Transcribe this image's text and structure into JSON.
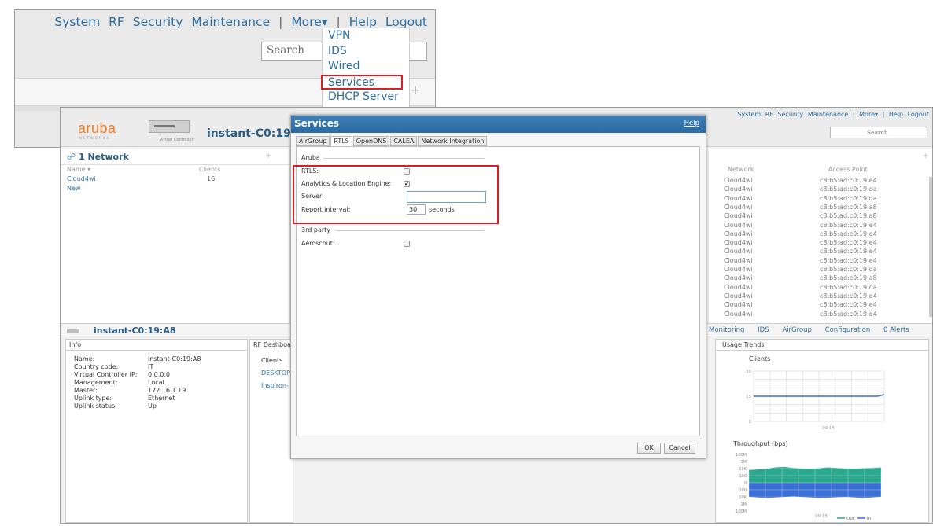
{
  "zoom_inset": {
    "nav": [
      "System",
      "RF",
      "Security",
      "Maintenance",
      "|",
      "More▾",
      "|",
      "Help",
      "Logout"
    ],
    "search_placeholder": "Search",
    "menu": [
      "VPN",
      "IDS",
      "Wired",
      "Services",
      "DHCP Server"
    ],
    "selected_item": "Services",
    "plus": "+"
  },
  "header": {
    "logo": "aruba",
    "logo_sub": "NETWORKS",
    "vc_label": "Virtual Controller",
    "vc_name": "instant-C0:19:",
    "nav": [
      "System",
      "RF",
      "Security",
      "Maintenance",
      "|",
      "More▾",
      "|",
      "Help",
      "Logout"
    ],
    "search_placeholder": "Search"
  },
  "networks": {
    "title": "1 Network",
    "plus": "+",
    "col_name": "Name ▾",
    "col_clients": "Clients",
    "rows": [
      {
        "name": "Cloud4wi",
        "clients": "16"
      }
    ],
    "new_link": "New"
  },
  "clients": {
    "plus": "+",
    "col_network": "Network",
    "col_ap": "Access Point",
    "rows": [
      {
        "network": "Cloud4wi",
        "ap": "c8:b5:ad:c0:19:e4"
      },
      {
        "network": "Cloud4wi",
        "ap": "c8:b5:ad:c0:19:da"
      },
      {
        "network": "Cloud4wi",
        "ap": "c8:b5:ad:c0:19:da"
      },
      {
        "network": "Cloud4wi",
        "ap": "c8:b5:ad:c0:19:a8"
      },
      {
        "network": "Cloud4wi",
        "ap": "c8:b5:ad:c0:19:a8"
      },
      {
        "network": "Cloud4wi",
        "ap": "c8:b5:ad:c0:19:e4"
      },
      {
        "network": "Cloud4wi",
        "ap": "c8:b5:ad:c0:19:e4"
      },
      {
        "network": "Cloud4wi",
        "ap": "c8:b5:ad:c0:19:e4"
      },
      {
        "network": "Cloud4wi",
        "ap": "c8:b5:ad:c0:19:e4"
      },
      {
        "network": "Cloud4wi",
        "ap": "c8:b5:ad:c0:19:e4"
      },
      {
        "network": "Cloud4wi",
        "ap": "c8:b5:ad:c0:19:da"
      },
      {
        "network": "Cloud4wi",
        "ap": "c8:b5:ad:c0:19:a8"
      },
      {
        "network": "Cloud4wi",
        "ap": "c8:b5:ad:c0:19:da"
      },
      {
        "network": "Cloud4wi",
        "ap": "c8:b5:ad:c0:19:e4"
      },
      {
        "network": "Cloud4wi",
        "ap": "c8:b5:ad:c0:19:e4"
      },
      {
        "network": "Cloud4wi",
        "ap": "c8:b5:ad:c0:19:e4"
      }
    ]
  },
  "lower": {
    "name": "instant-C0:19:A8",
    "tabs": [
      "Monitoring",
      "IDS",
      "AirGroup",
      "Configuration",
      "0 Alerts"
    ],
    "info_title": "Info",
    "info": [
      {
        "k": "Name:",
        "v": "instant-C0:19:A8"
      },
      {
        "k": "Country code:",
        "v": "IT"
      },
      {
        "k": "Virtual Controller IP:",
        "v": "0.0.0.0"
      },
      {
        "k": "Management:",
        "v": "Local"
      },
      {
        "k": "Master:",
        "v": "172.16.1.19"
      },
      {
        "k": "Uplink type:",
        "v": "Ethernet"
      },
      {
        "k": "Uplink status:",
        "v": "Up"
      }
    ],
    "rf_title": "RF Dashboard",
    "rf_clients": "Clients",
    "rf_links": [
      "DESKTOP",
      "Inspiron-"
    ],
    "usage_title": "Usage Trends",
    "clients_chart_title": "Clients",
    "throughput_title": "Throughput  (bps)"
  },
  "dialog": {
    "title": "Services",
    "help": "Help",
    "tabs": [
      "AirGroup",
      "RTLS",
      "OpenDNS",
      "CALEA",
      "Network Integration"
    ],
    "active_tab": "RTLS",
    "aruba_section": "Aruba",
    "rtls_label": "RTLS:",
    "ale_label": "Analytics & Location Engine:",
    "server_label": "Server:",
    "server_value": "",
    "interval_label": "Report interval:",
    "interval_value": "30",
    "interval_unit": "seconds",
    "third_party_section": "3rd party",
    "aeroscout_label": "Aeroscout:",
    "rtls_checked": false,
    "ale_checked": true,
    "aeroscout_checked": false,
    "ok": "OK",
    "cancel": "Cancel"
  },
  "chart_data": [
    {
      "type": "line",
      "title": "Clients",
      "ylim": [
        0,
        30
      ],
      "y_ticks": [
        "0",
        "15",
        "30"
      ],
      "x_ticks": [
        "09:15"
      ],
      "series": [
        {
          "values": [
            15,
            15,
            15,
            15,
            15,
            15,
            15,
            15,
            15,
            15,
            15,
            15,
            15,
            15,
            15,
            15,
            15,
            15,
            15,
            16
          ]
        }
      ],
      "color": "#3d6fb0"
    },
    {
      "type": "area",
      "title": "Throughput  (bps)",
      "y_ticks": [
        "100M",
        "1M",
        "10K",
        "100",
        "0",
        "100",
        "10K",
        "1M",
        "100M"
      ],
      "x_ticks": [
        "09:15"
      ],
      "series": [
        {
          "name": "Out",
          "values": [
            50,
            52,
            55,
            60,
            62,
            58,
            56,
            55,
            57,
            60,
            58,
            56,
            55,
            57,
            58,
            60
          ],
          "color": "#2aa98f"
        },
        {
          "name": "In",
          "values": [
            55,
            58,
            60,
            58,
            56,
            54,
            56,
            58,
            60,
            59,
            57,
            56,
            58,
            60,
            58,
            55
          ],
          "color": "#3b6fd6"
        }
      ],
      "legend": "bottom-right"
    }
  ]
}
